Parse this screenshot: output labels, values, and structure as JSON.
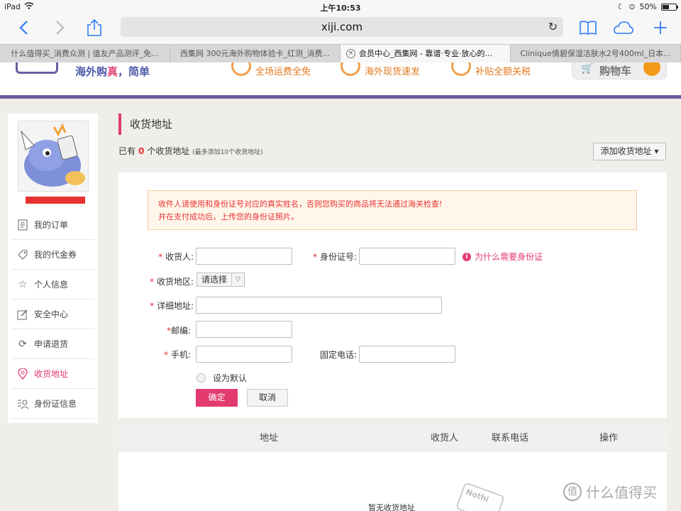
{
  "status_bar": {
    "device": "iPad",
    "time": "上午10:53",
    "battery": "50%",
    "battery_level": 0.5
  },
  "browser": {
    "url": "xiji.com",
    "tabs": [
      {
        "label": "什么值得买_消费众测 | 值友产品测评_免...",
        "active": false
      },
      {
        "label": "西集网 300元海外购物体验卡_红测_消费...",
        "active": false
      },
      {
        "label": "会员中心_西集网 - 靠谱·专业·放心的...",
        "active": true
      },
      {
        "label": "Clinique倩碧保湿洁肤水2号400ml_日本...",
        "active": false
      }
    ]
  },
  "site_header": {
    "slogan_part1": "海外购",
    "slogan_part2": "真",
    "slogan_part3": "，简单",
    "promos": [
      "全场运费全免",
      "海外现货速发",
      "补贴全额关税"
    ],
    "cart_label": "购物车"
  },
  "sidebar": {
    "items": [
      {
        "label": "我的订单",
        "icon": "order-icon",
        "active": false
      },
      {
        "label": "我的代金券",
        "icon": "coupon-icon",
        "active": false
      },
      {
        "label": "个人信息",
        "icon": "star-icon",
        "active": false
      },
      {
        "label": "安全中心",
        "icon": "edit-icon",
        "active": false
      },
      {
        "label": "申请退货",
        "icon": "refresh-icon",
        "active": false
      },
      {
        "label": "收货地址",
        "icon": "location-icon",
        "active": true
      },
      {
        "label": "身份证信息",
        "icon": "id-card-icon",
        "active": false
      }
    ]
  },
  "main": {
    "title": "收货地址",
    "count_prefix": "已有",
    "count": "0",
    "count_suffix": "个收货地址",
    "count_note": "(最多添加10个收货地址)",
    "add_button": "添加收货地址 ▾",
    "notice_line1": "收件人请使用和身份证号对应的真实姓名，否则您购买的商品将无法通过海关检查!",
    "notice_line2": "并在支付成功后，上传您的身份证照片。",
    "form": {
      "recipient_label": "收货人:",
      "id_label": "身份证号:",
      "why_id": "为什么需要身份证",
      "region_label": "收货地区:",
      "region_value": "请选择",
      "address_label": "详细地址:",
      "zip_label": "邮编:",
      "mobile_label": "手机:",
      "phone_label": "固定电话:",
      "default_label": "设为默认",
      "confirm": "确定",
      "cancel": "取消"
    },
    "table": {
      "headers": [
        "地址",
        "收货人",
        "联系电话",
        "操作"
      ],
      "empty_text": "暂无收货地址",
      "empty_graphic_text": "Nothi"
    }
  },
  "watermark": {
    "text": "什么值得买",
    "logo": "值"
  }
}
